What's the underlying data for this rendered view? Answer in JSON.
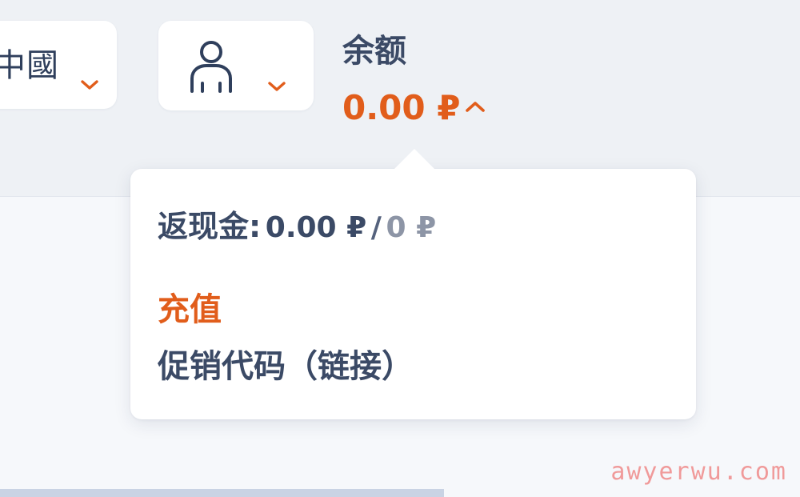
{
  "header": {
    "language": {
      "label": "中國",
      "chevron_icon": "chevron-down-icon"
    },
    "account": {
      "icon": "user-icon",
      "chevron_icon": "chevron-down-icon"
    },
    "balance": {
      "label": "余额",
      "amount": "0.00 ₽",
      "toggle_icon": "chevron-up-icon"
    }
  },
  "balance_popover": {
    "cashback": {
      "label": "返现金:",
      "value": "0.00 ₽",
      "separator": "/",
      "limit": "0 ₽"
    },
    "top_up_label": "充值",
    "promo_code_label": "促销代码（链接）"
  },
  "watermark": {
    "text": "awyerwu.com"
  },
  "colors": {
    "accent_orange": "#e15d1b",
    "text_dark": "#3b4a66",
    "text_muted": "#8d95a6",
    "card_bg": "#ffffff",
    "page_bg": "#eef1f5",
    "watermark": "#f09a9a"
  }
}
